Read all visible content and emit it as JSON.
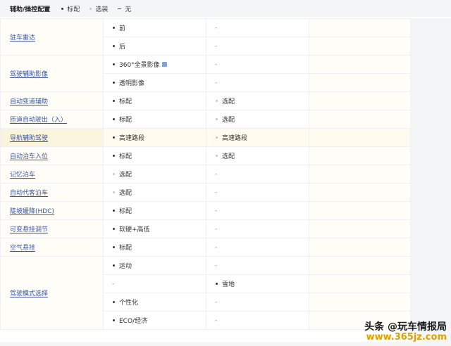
{
  "header": {
    "title": "辅助/操控配置",
    "legend": [
      {
        "marker": "dot",
        "label": "标配",
        "color": "#333333"
      },
      {
        "marker": "dot",
        "label": "选装",
        "color": "#c7c7c7"
      },
      {
        "marker": "dash",
        "label": "无",
        "color": "#555555"
      }
    ]
  },
  "rows": [
    {
      "label": "驻车雷达",
      "rowspan": 2,
      "cells": [
        {
          "kind": "std",
          "text": "前"
        },
        {
          "kind": "none",
          "text": "-"
        }
      ]
    },
    {
      "cells": [
        {
          "kind": "std",
          "text": "后"
        },
        {
          "kind": "none",
          "text": "-"
        }
      ]
    },
    {
      "label": "驾驶辅助影像",
      "rowspan": 2,
      "cells": [
        {
          "kind": "std",
          "text": "360°全景影像",
          "badge": true
        },
        {
          "kind": "none",
          "text": "-"
        }
      ]
    },
    {
      "cells": [
        {
          "kind": "std",
          "text": "透明影像"
        },
        {
          "kind": "none",
          "text": "-"
        }
      ]
    },
    {
      "label": "自动变道辅助",
      "cells": [
        {
          "kind": "std",
          "text": "标配"
        },
        {
          "kind": "opt",
          "text": "选配"
        }
      ]
    },
    {
      "label": "匝道自动驶出（入）",
      "cells": [
        {
          "kind": "std",
          "text": "标配"
        },
        {
          "kind": "opt",
          "text": "选配"
        }
      ]
    },
    {
      "label": "导航辅助驾驶",
      "highlight": true,
      "cells": [
        {
          "kind": "std",
          "text": "高速路段"
        },
        {
          "kind": "opt",
          "text": "高速路段"
        }
      ]
    },
    {
      "label": "自动泊车入位",
      "cells": [
        {
          "kind": "std",
          "text": "标配"
        },
        {
          "kind": "opt",
          "text": "选配"
        }
      ]
    },
    {
      "label": "记忆泊车",
      "cells": [
        {
          "kind": "opt",
          "text": "选配"
        },
        {
          "kind": "none",
          "text": "-"
        }
      ]
    },
    {
      "label": "自动代客泊车",
      "cells": [
        {
          "kind": "opt",
          "text": "选配"
        },
        {
          "kind": "none",
          "text": "-"
        }
      ]
    },
    {
      "label": "陡坡缓降(HDC)",
      "cells": [
        {
          "kind": "std",
          "text": "标配"
        },
        {
          "kind": "none",
          "text": "-"
        }
      ]
    },
    {
      "label": "可变悬挂调节",
      "cells": [
        {
          "kind": "std",
          "text": "软硬+高低"
        },
        {
          "kind": "none",
          "text": "-"
        }
      ]
    },
    {
      "label": "空气悬挂",
      "cells": [
        {
          "kind": "std",
          "text": "标配"
        },
        {
          "kind": "none",
          "text": "-"
        }
      ]
    },
    {
      "label": "驾驶模式选择",
      "rowspan": 4,
      "cells": [
        {
          "kind": "std",
          "text": "运动"
        },
        {
          "kind": "none",
          "text": "-"
        }
      ]
    },
    {
      "cells": [
        {
          "kind": "none",
          "text": "-"
        },
        {
          "kind": "std",
          "text": "雪地"
        }
      ]
    },
    {
      "cells": [
        {
          "kind": "std",
          "text": "个性化"
        },
        {
          "kind": "none",
          "text": "-"
        }
      ]
    },
    {
      "cells": [
        {
          "kind": "std",
          "text": "ECO/经济"
        },
        {
          "kind": "none",
          "text": "-"
        }
      ]
    }
  ],
  "watermark": {
    "line1": "头条 @玩车情报局",
    "line2": "www.365jz.com"
  }
}
